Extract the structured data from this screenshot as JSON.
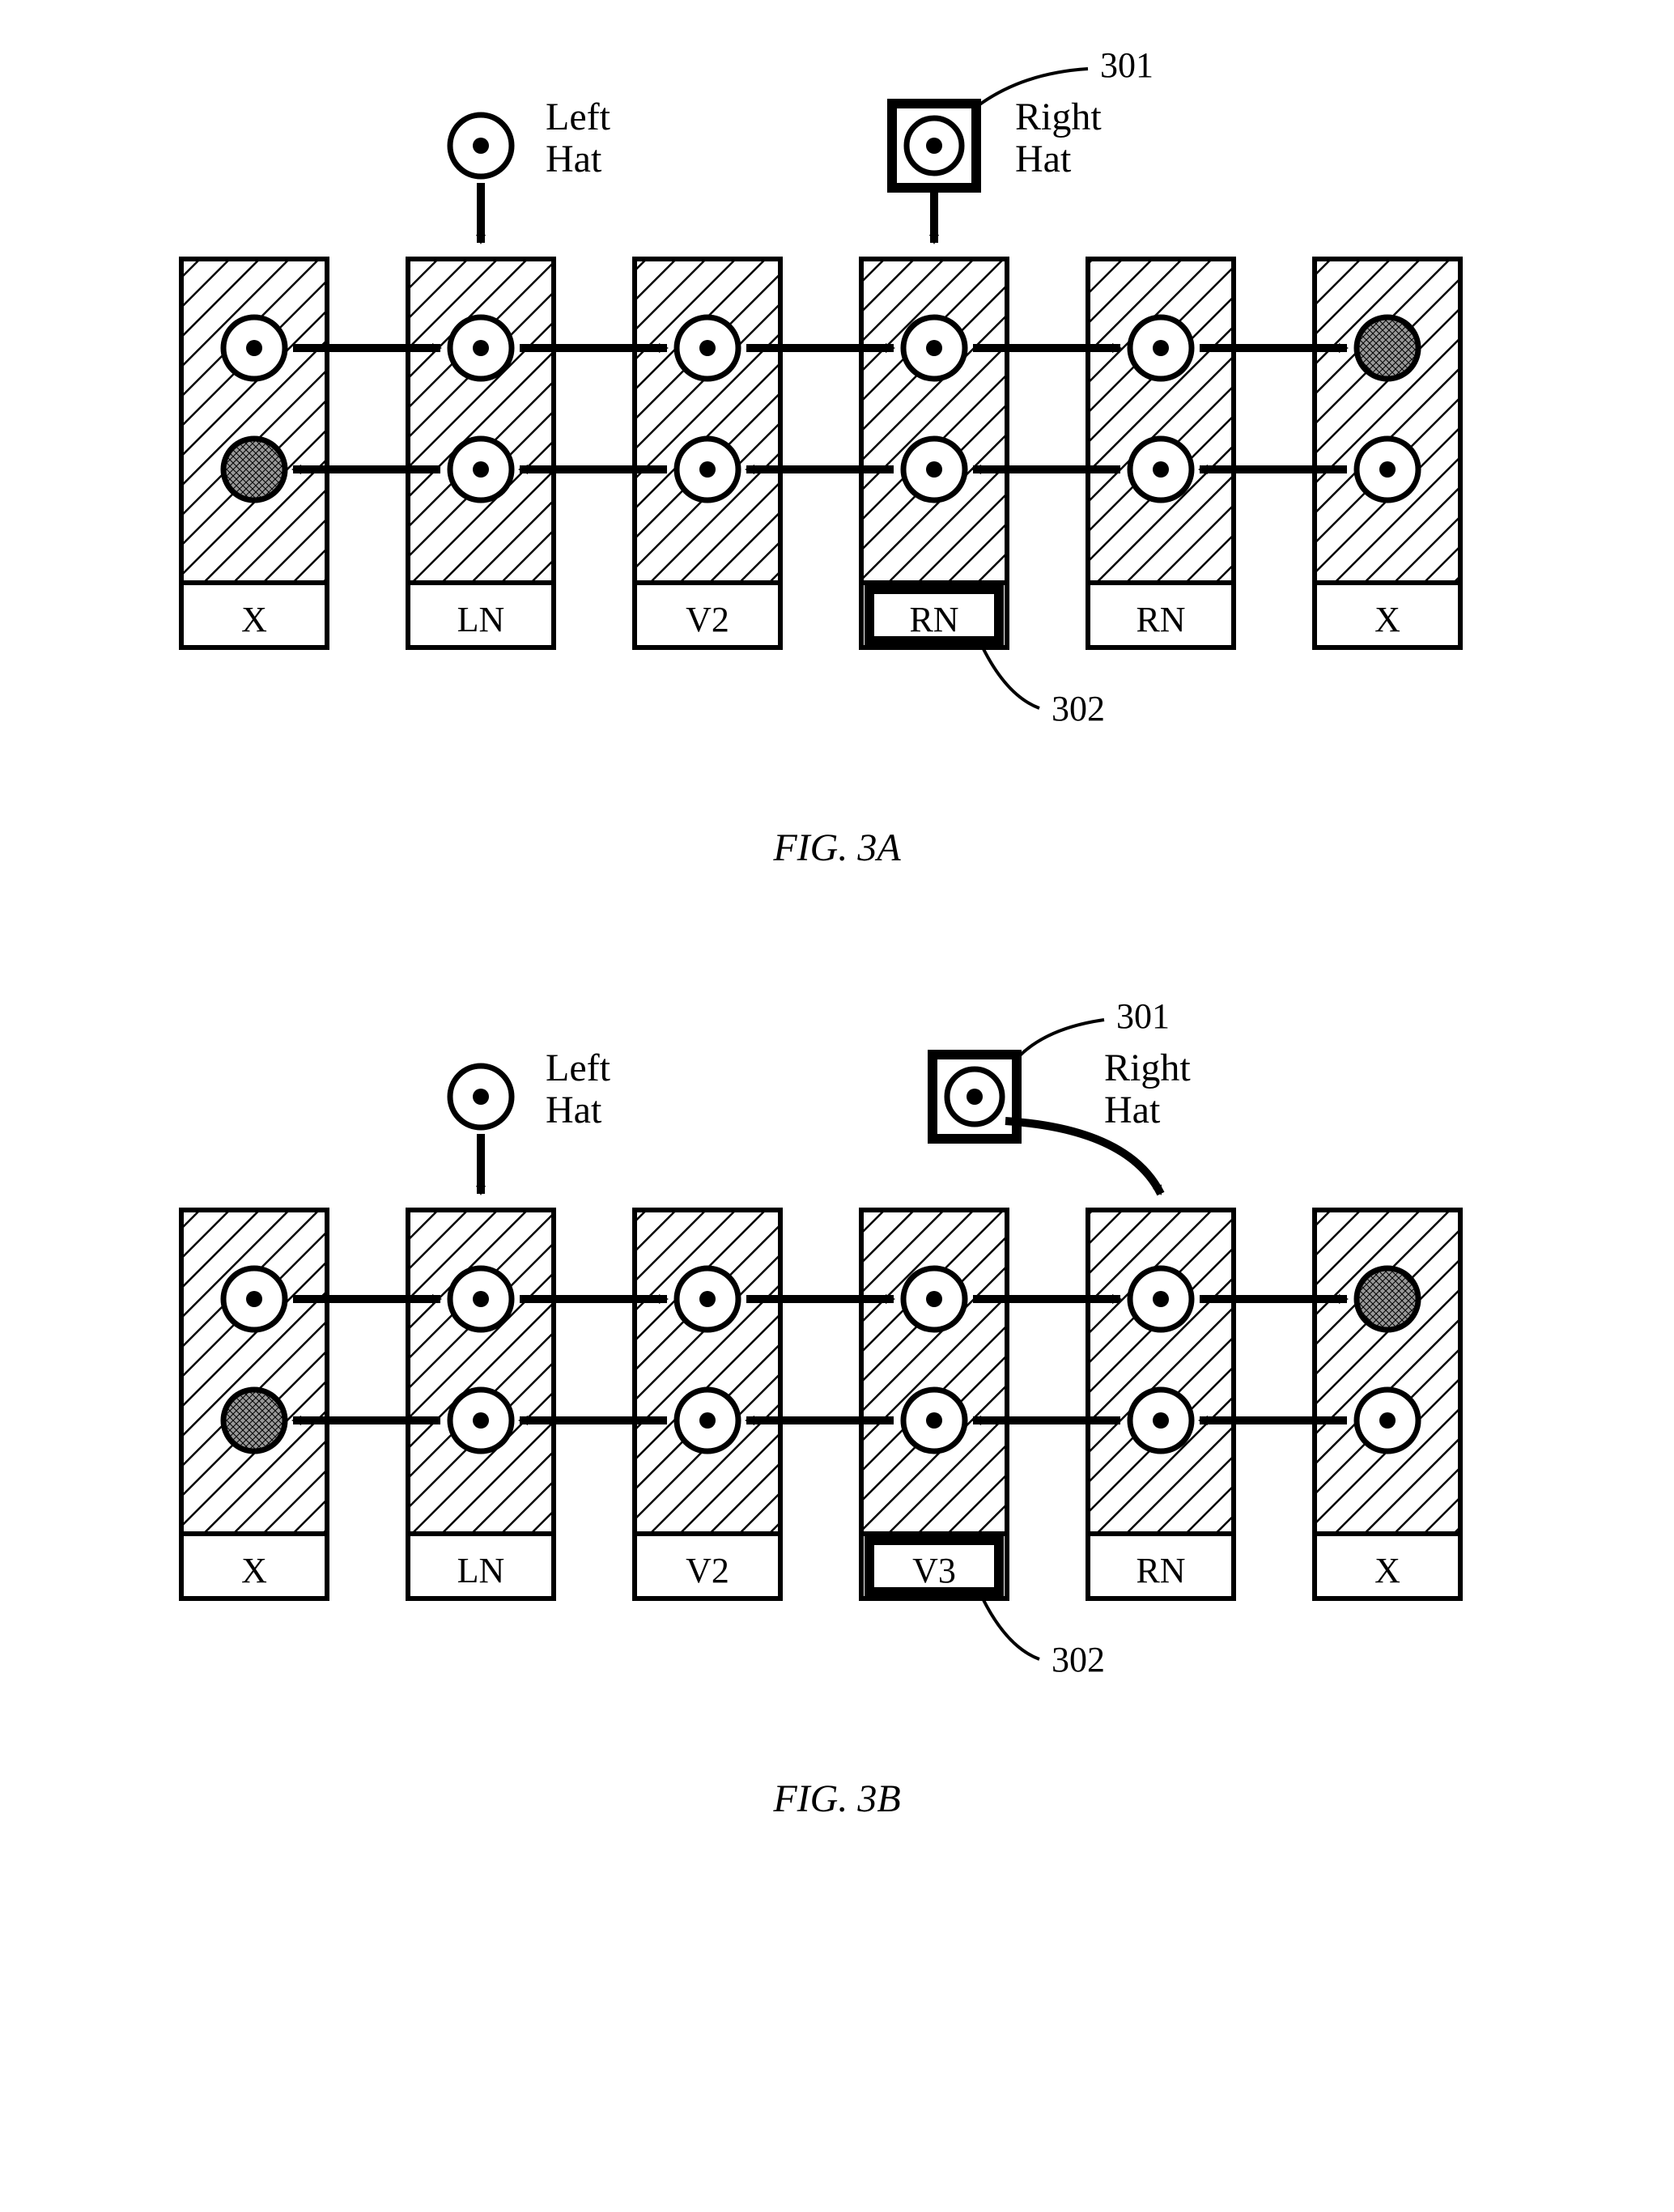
{
  "figA": {
    "caption": "FIG. 3A",
    "leftHat": "Left\nHat",
    "rightHat": "Right\nHat",
    "callout301": "301",
    "callout302": "302",
    "boxes": [
      "X",
      "LN",
      "V2",
      "RN",
      "RN",
      "X"
    ],
    "highlightBoxIndex": 3
  },
  "figB": {
    "caption": "FIG. 3B",
    "leftHat": "Left\nHat",
    "rightHat": "Right\nHat",
    "callout301": "301",
    "callout302": "302",
    "boxes": [
      "X",
      "LN",
      "V2",
      "V3",
      "RN",
      "X"
    ],
    "highlightBoxIndex": 3
  }
}
